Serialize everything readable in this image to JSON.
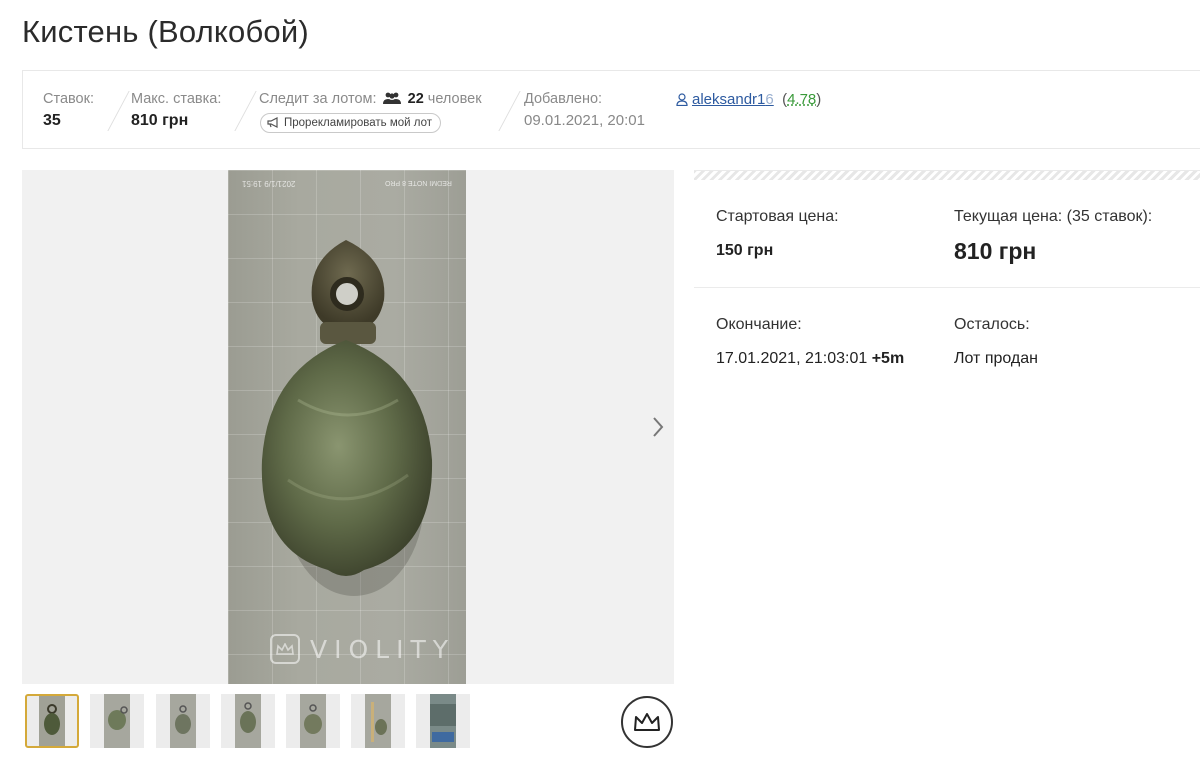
{
  "lot": {
    "title": "Кистень (Волкобой)"
  },
  "stats": {
    "bids_label": "Ставок:",
    "bids_value": "35",
    "max_bid_label": "Макс. ставка:",
    "max_bid_value": "810 грн",
    "watching_label": "Следит за лотом:",
    "watching_count": "22",
    "watching_suffix": "человек",
    "promote_button": "Прорекламировать мой лот",
    "added_label": "Добавлено:",
    "added_value": "09.01.2021, 20:01",
    "seller_name": "aleksandr1",
    "seller_name_fade": "6",
    "seller_rating": "4.78",
    "seller_rating_open": "(",
    "seller_rating_close": ")"
  },
  "gallery": {
    "watermark_text": "VIOLITY",
    "photo_stamp": "2021/1/9 19:51",
    "photo_stamp2": "REDMI NOTE 8 PRO",
    "thumbnail_count": 7,
    "active_thumbnail": 1
  },
  "pricing": {
    "start_price_label": "Стартовая цена:",
    "start_price_value": "150 грн",
    "current_price_label": "Текущая цена: (35 ставок):",
    "current_price_value": "810 грн",
    "end_label": "Окончание:",
    "end_value": "17.01.2021, 21:03:01",
    "end_extra": "+5m",
    "remaining_label": "Осталось:",
    "remaining_value": "Лот продан"
  },
  "colors": {
    "link": "#2d5aa0",
    "rating": "#3a9a3a",
    "active_thumb_border": "#d4a93a"
  },
  "icons": [
    "people-icon",
    "megaphone-icon",
    "user-icon",
    "chevron-right-icon",
    "crown-icon"
  ]
}
